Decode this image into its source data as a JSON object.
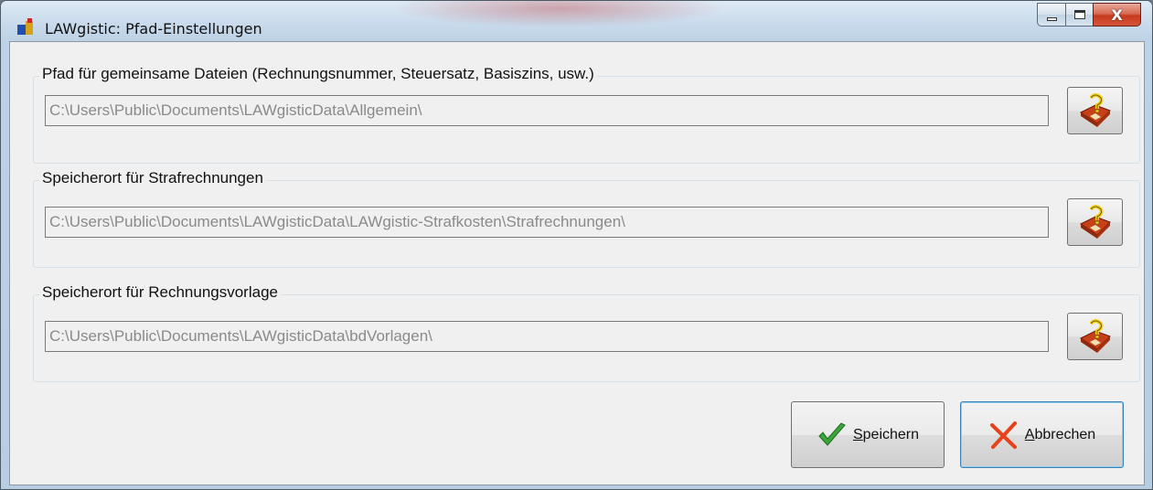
{
  "window": {
    "title": "LAWgistic: Pfad-Einstellungen",
    "controls": {
      "minimize": "—",
      "maximize": "□",
      "close": "X"
    }
  },
  "groups": [
    {
      "label": "Pfad für gemeinsame Dateien (Rechnungsnummer, Steuersatz, Basiszins, usw.)",
      "path": "C:\\Users\\Public\\Documents\\LAWgisticData\\Allgemein\\"
    },
    {
      "label": "Speicherort für Strafrechnungen",
      "path": "C:\\Users\\Public\\Documents\\LAWgisticData\\LAWgistic-Strafkosten\\Strafrechnungen\\"
    },
    {
      "label": "Speicherort für Rechnungsvorlage",
      "path": "C:\\Users\\Public\\Documents\\LAWgisticData\\bdVorlagen\\"
    }
  ],
  "buttons": {
    "save": "Speichern",
    "cancel": "Abbrechen"
  },
  "icons": {
    "title": "app-icon",
    "browse": "folder-question-icon",
    "save": "checkmark-icon",
    "cancel": "cross-icon"
  },
  "colors": {
    "accent_check": "#3aa53a",
    "accent_cross": "#e8421a",
    "folder": "#c8401a",
    "question": "#f2d21b"
  }
}
